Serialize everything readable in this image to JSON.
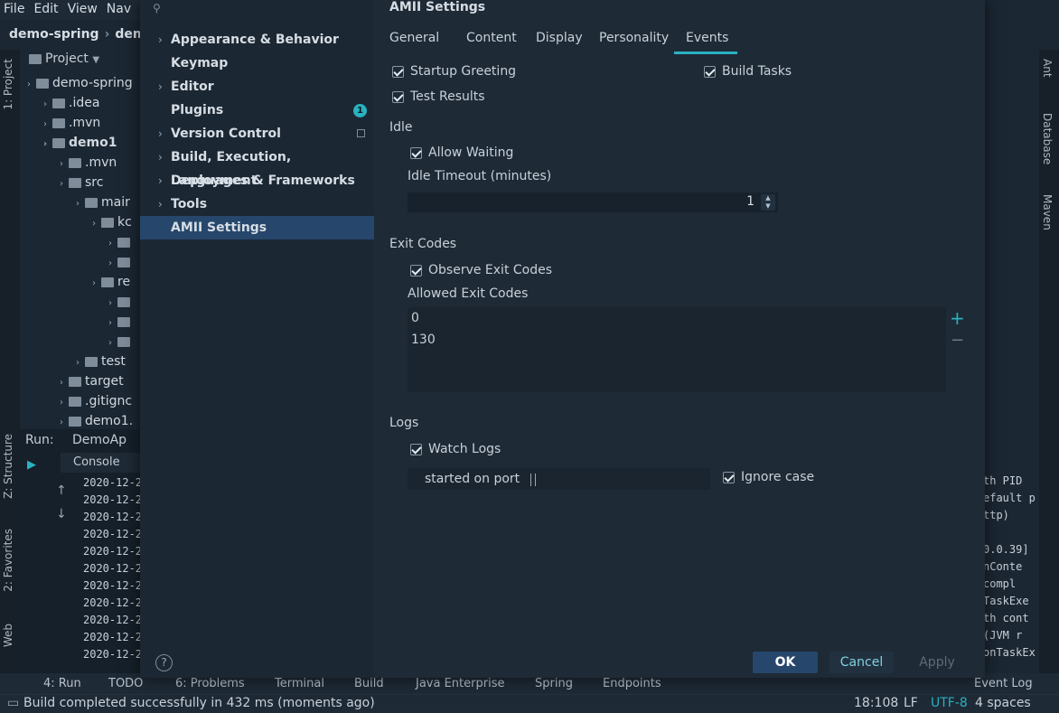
{
  "ide": {
    "menu": [
      "File",
      "Edit",
      "View",
      "Nav"
    ],
    "breadcrumb": [
      "demo-spring",
      "demo"
    ],
    "project_label": "Project",
    "left_tabs": [
      "1: Project",
      "Z: Structure",
      "2: Favorites",
      "Web"
    ],
    "right_tabs": [
      "Ant",
      "Database",
      "Maven"
    ],
    "tree": [
      {
        "label": "demo-spring",
        "indent": 0,
        "bold": false
      },
      {
        "label": ".idea",
        "indent": 1,
        "bold": false
      },
      {
        "label": ".mvn",
        "indent": 1,
        "bold": false
      },
      {
        "label": "demo1",
        "indent": 1,
        "bold": true
      },
      {
        "label": ".mvn",
        "indent": 2,
        "bold": false
      },
      {
        "label": "src",
        "indent": 2,
        "bold": false
      },
      {
        "label": "mair",
        "indent": 3,
        "bold": false
      },
      {
        "label": "kc",
        "indent": 4,
        "bold": false
      },
      {
        "label": "",
        "indent": 5,
        "bold": false
      },
      {
        "label": "",
        "indent": 5,
        "bold": false
      },
      {
        "label": "re",
        "indent": 4,
        "bold": false
      },
      {
        "label": "",
        "indent": 5,
        "bold": false
      },
      {
        "label": "",
        "indent": 5,
        "bold": false
      },
      {
        "label": "",
        "indent": 5,
        "bold": false
      },
      {
        "label": "test",
        "indent": 3,
        "bold": false
      },
      {
        "label": "target",
        "indent": 2,
        "bold": false
      },
      {
        "label": ".gitignc",
        "indent": 2,
        "bold": false
      },
      {
        "label": "demo1.",
        "indent": 2,
        "bold": false
      }
    ],
    "run_label": "Run:",
    "run_config": "DemoAp",
    "console_tab": "Console",
    "log_lines": [
      "2020-12-2",
      "2020-12-2",
      "2020-12-2",
      "2020-12-2",
      "2020-12-2",
      "2020-12-2",
      "2020-12-2",
      "2020-12-2",
      "2020-12-2",
      "2020-12-2",
      "2020-12-2"
    ],
    "right_log_lines": [
      "th PID",
      "efault p",
      "ttp)",
      "",
      "0.0.39]",
      "nConte",
      "compl",
      "TaskExe",
      "th cont",
      " (JVM r",
      "onTaskEx"
    ],
    "bottom_tabs": [
      "4: Run",
      "TODO",
      "6: Problems",
      "Terminal",
      "Build",
      "Java Enterprise",
      "Spring",
      "Endpoints",
      "Event Log"
    ],
    "status_message": "Build completed successfully in 432 ms (moments ago)",
    "status_right": [
      "18:108",
      "LF",
      "UTF-8",
      "4 spaces"
    ]
  },
  "settings_nav": {
    "items": [
      {
        "label": "Appearance & Behavior",
        "chevron": true
      },
      {
        "label": "Keymap",
        "chevron": false
      },
      {
        "label": "Editor",
        "chevron": true
      },
      {
        "label": "Plugins",
        "chevron": false
      },
      {
        "label": "Version Control",
        "chevron": true
      },
      {
        "label": "Build, Execution, Deployment",
        "chevron": true
      },
      {
        "label": "Languages & Frameworks",
        "chevron": true
      },
      {
        "label": "Tools",
        "chevron": true
      },
      {
        "label": "AMII Settings",
        "chevron": false
      }
    ],
    "plugins_badge": "1",
    "help": "?"
  },
  "content": {
    "title": "AMII Settings",
    "tabs": [
      "General",
      "Content",
      "Display",
      "Personality",
      "Events"
    ],
    "active_tab": "Events",
    "checkboxes": {
      "startup_greeting": "Startup Greeting",
      "build_tasks": "Build Tasks",
      "test_results": "Test Results",
      "allow_waiting": "Allow Waiting",
      "observe_exit_codes": "Observe Exit Codes",
      "watch_logs": "Watch Logs",
      "ignore_case": "Ignore case"
    },
    "sections": {
      "idle": "Idle",
      "exit_codes": "Exit Codes",
      "logs": "Logs"
    },
    "idle_timeout_label": "Idle Timeout (minutes)",
    "idle_timeout_value": "1",
    "allowed_exit_codes_label": "Allowed Exit Codes",
    "exit_codes": [
      "0",
      "130"
    ],
    "log_pattern": "started on port"
  },
  "buttons": {
    "ok": "OK",
    "cancel": "Cancel",
    "apply": "Apply"
  },
  "colors": {
    "accent": "#29b2c0",
    "selection": "#26476b",
    "dialog_bg": "#1e2a36"
  }
}
